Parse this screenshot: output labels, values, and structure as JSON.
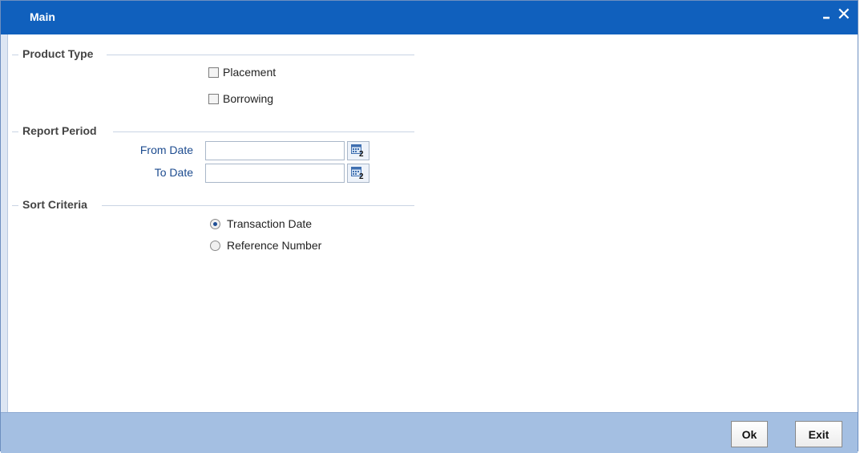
{
  "window": {
    "title": "Main",
    "minimize_icon": "minimize-icon",
    "close_icon": "close-icon"
  },
  "product_type": {
    "legend": "Product Type",
    "options": [
      {
        "label": "Placement",
        "checked": false
      },
      {
        "label": "Borrowing",
        "checked": false
      }
    ]
  },
  "report_period": {
    "legend": "Report Period",
    "from_label": "From Date",
    "from_value": "",
    "to_label": "To Date",
    "to_value": "",
    "calendar_icon": "calendar-icon"
  },
  "sort_criteria": {
    "legend": "Sort Criteria",
    "options": [
      {
        "label": "Transaction Date",
        "selected": true
      },
      {
        "label": "Reference Number",
        "selected": false
      }
    ]
  },
  "footer": {
    "ok_label": "Ok",
    "exit_label": "Exit"
  },
  "colors": {
    "titlebar": "#1060bd",
    "footer": "#a4bfe2",
    "field_label": "#1c4b8f"
  }
}
